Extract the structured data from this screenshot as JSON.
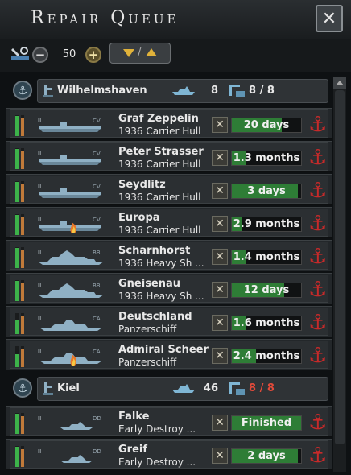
{
  "window": {
    "title": "Repair Queue",
    "close_label": "✕"
  },
  "controls": {
    "value": "50",
    "minus_label": "−",
    "plus_label": "+",
    "sort_sep": "/"
  },
  "groups": [
    {
      "port": "Wilhelmshaven",
      "ships": "8",
      "docks": "8 / 8",
      "docks_color": "#e8e8e8",
      "rows": [
        {
          "name": "Graf Zeppelin",
          "class": "1936 Carrier Hull",
          "time": "20 days",
          "progress": 0.72,
          "hp": 0.95,
          "org": 0.85,
          "type": "CV",
          "fire": false
        },
        {
          "name": "Peter Strasser",
          "class": "1936 Carrier Hull",
          "time": "1.3 months",
          "progress": 0.2,
          "hp": 0.95,
          "org": 0.85,
          "type": "CV",
          "fire": false
        },
        {
          "name": "Seydlitz",
          "class": "1936 Carrier Hull",
          "time": "3 days",
          "progress": 0.95,
          "hp": 0.95,
          "org": 0.85,
          "type": "CV",
          "fire": false
        },
        {
          "name": "Europa",
          "class": "1936 Carrier Hull",
          "time": "2.9 months",
          "progress": 0.15,
          "hp": 0.95,
          "org": 0.85,
          "type": "CV",
          "fire": true
        },
        {
          "name": "Scharnhorst",
          "class": "1936 Heavy Sh ...",
          "time": "1.4 months",
          "progress": 0.2,
          "hp": 0.95,
          "org": 0.85,
          "type": "BB",
          "fire": false
        },
        {
          "name": "Gneisenau",
          "class": "1936 Heavy Sh ...",
          "time": "12 days",
          "progress": 0.75,
          "hp": 0.95,
          "org": 0.85,
          "type": "BB",
          "fire": false
        },
        {
          "name": "Deutschland",
          "class": "Panzerschiff",
          "time": "1.6 months",
          "progress": 0.2,
          "hp": 0.7,
          "org": 0.85,
          "type": "CA",
          "fire": false
        },
        {
          "name": "Admiral Scheer",
          "class": "Panzerschiff",
          "time": "2.4 months",
          "progress": 0.35,
          "hp": 0.6,
          "org": 0.85,
          "type": "CA",
          "fire": true
        }
      ]
    },
    {
      "port": "Kiel",
      "ships": "46",
      "docks": "8 / 8",
      "docks_color": "#e04a3a",
      "rows": [
        {
          "name": "Falke",
          "class": "Early Destroy ...",
          "time": "Finished",
          "progress": 1.0,
          "hp": 0.95,
          "org": 0.85,
          "type": "DD",
          "fire": false
        },
        {
          "name": "Greif",
          "class": "Early Destroy ...",
          "time": "2 days",
          "progress": 0.95,
          "hp": 0.95,
          "org": 0.85,
          "type": "DD",
          "fire": false
        }
      ]
    }
  ],
  "colors": {
    "progress": "#2e7d36",
    "anchor": "#c62a2a",
    "hp": "#3db34a",
    "org": "#c07a3a"
  },
  "icons": {
    "close": "close-icon",
    "repair": "wrench-icon",
    "port": "anchor-icon",
    "ship": "ship-icon",
    "dock": "dockyard-icon",
    "cancel": "x-icon",
    "fire": "fire-icon"
  }
}
